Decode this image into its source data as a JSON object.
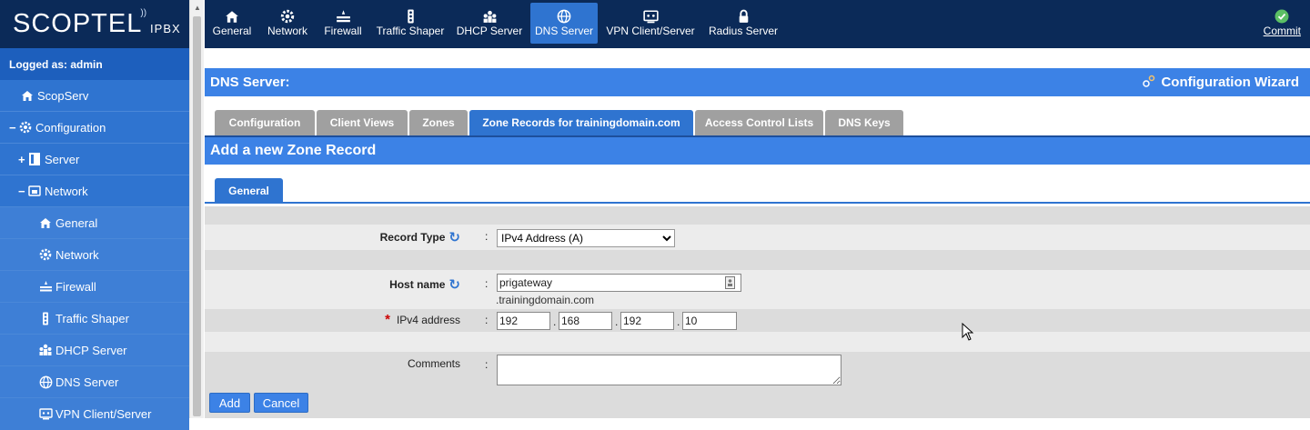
{
  "logo": {
    "main": "SCOPTEL",
    "suffix": "IPBX"
  },
  "sidebar": {
    "logged_as": "Logged as: admin",
    "items": [
      {
        "label": "ScopServ",
        "icon": "home-icon",
        "toggle": ""
      },
      {
        "label": "Configuration",
        "icon": "gear-icon",
        "toggle": "−"
      },
      {
        "label": "Server",
        "icon": "server-icon",
        "toggle": "+"
      },
      {
        "label": "Network",
        "icon": "network-icon",
        "toggle": "−"
      },
      {
        "label": "General",
        "icon": "home-icon"
      },
      {
        "label": "Network",
        "icon": "gear-icon"
      },
      {
        "label": "Firewall",
        "icon": "firewall-icon"
      },
      {
        "label": "Traffic Shaper",
        "icon": "traffic-light-icon"
      },
      {
        "label": "DHCP Server",
        "icon": "users-icon"
      },
      {
        "label": "DNS Server",
        "icon": "globe-icon"
      },
      {
        "label": "VPN Client/Server",
        "icon": "vpn-icon"
      }
    ]
  },
  "topbar": {
    "items": [
      {
        "label": "General",
        "icon": "home-icon"
      },
      {
        "label": "Network",
        "icon": "gear-icon"
      },
      {
        "label": "Firewall",
        "icon": "firewall-icon"
      },
      {
        "label": "Traffic Shaper",
        "icon": "traffic-light-icon"
      },
      {
        "label": "DHCP Server",
        "icon": "users-icon"
      },
      {
        "label": "DNS Server",
        "icon": "globe-icon",
        "active": true
      },
      {
        "label": "VPN Client/Server",
        "icon": "vpn-icon"
      },
      {
        "label": "Radius Server",
        "icon": "lock-icon"
      }
    ],
    "commit_label": "Commit"
  },
  "page": {
    "title": "DNS Server:",
    "wizard_label": "Configuration Wizard"
  },
  "tabs": [
    {
      "label": "Configuration"
    },
    {
      "label": "Client Views"
    },
    {
      "label": "Zones"
    },
    {
      "label": "Zone Records for trainingdomain.com",
      "active": true
    },
    {
      "label": "Access Control Lists"
    },
    {
      "label": "DNS Keys"
    }
  ],
  "form": {
    "header": "Add a new Zone Record",
    "subtab": "General",
    "record_type_label": "Record Type",
    "record_type_value": "IPv4 Address (A)",
    "host_name_label": "Host name",
    "host_name_value": "prigateway",
    "domain_suffix": ".trainingdomain.com",
    "ipv4_label": "IPv4 address",
    "ipv4": [
      "192",
      "168",
      "192",
      "10"
    ],
    "comments_label": "Comments",
    "comments_value": "",
    "colon": ":",
    "dot": ".",
    "required_mark": "*"
  },
  "buttons": {
    "add": "Add",
    "cancel": "Cancel"
  },
  "colors": {
    "nav_bg": "#0b2a58",
    "accent": "#3c82e6",
    "sidebar": "#2f74d0",
    "tab_inactive": "#a0a0a0"
  }
}
